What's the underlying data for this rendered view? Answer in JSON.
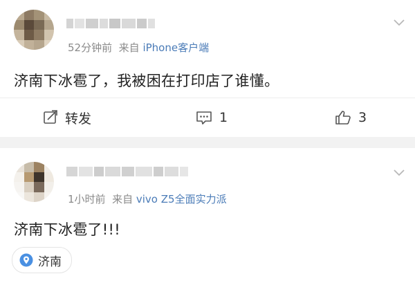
{
  "posts": [
    {
      "time": "52分钟前",
      "source_prefix": "来自",
      "source": "iPhone客户端",
      "text": "济南下冰雹了，我被困在打印店了谁懂。",
      "actions": {
        "repost_label": "转发",
        "comment_count": "1",
        "like_count": "3"
      }
    },
    {
      "time": "1小时前",
      "source_prefix": "来自",
      "source": "vivo Z5全面实力派",
      "text": "济南下冰雹了!!!",
      "location": "济南"
    }
  ],
  "colors": {
    "accent_link": "#4a7bb7",
    "location_pin": "#4a90e2",
    "separator": "#f2f2f2"
  }
}
